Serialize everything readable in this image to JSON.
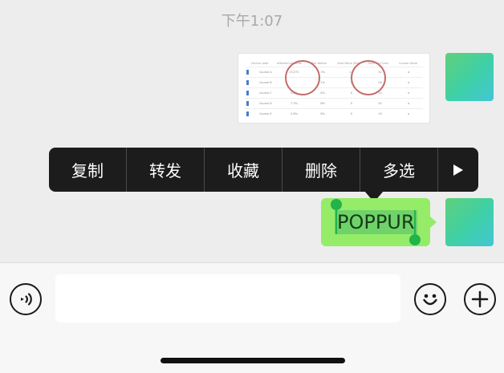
{
  "chat": {
    "timestamp": "下午1:07",
    "image_message": {
      "columns": [
        "Course code",
        "Affected students",
        "Rev Before",
        "Gold Value (Rev)",
        "Impr Rev Gain",
        "Course Value",
        ""
      ],
      "rows": [
        [
          "Course A",
          "",
          "3%",
          "12",
          "",
          "32",
          "a"
        ],
        [
          "Course B",
          "",
          "1%",
          "1",
          "",
          "26",
          "a"
        ],
        [
          "Course C",
          "3.2%",
          "8%",
          "0",
          "",
          "14",
          "a"
        ],
        [
          "Course D",
          "7.3%",
          "8%",
          "0",
          "",
          "30",
          "a"
        ],
        [
          "Course E",
          "2.8%",
          "8%",
          "0",
          "",
          "19",
          "a"
        ]
      ],
      "highlight_values": [
        "23,571",
        "1.1"
      ]
    },
    "text_message": "POPPUR",
    "avatar_color": "#4fcf95"
  },
  "context_menu": {
    "items": [
      "复制",
      "转发",
      "收藏",
      "删除",
      "多选"
    ],
    "more_icon": "play-right-icon"
  },
  "input_bar": {
    "voice_icon": "voice-wave-icon",
    "input_value": "",
    "emoji_icon": "smile-face-icon",
    "add_icon": "plus-circle-icon"
  },
  "colors": {
    "background": "#ededed",
    "bubble_green": "#95ec69",
    "selection_handle": "#21b34c",
    "menu_bg": "#1c1c1c"
  }
}
